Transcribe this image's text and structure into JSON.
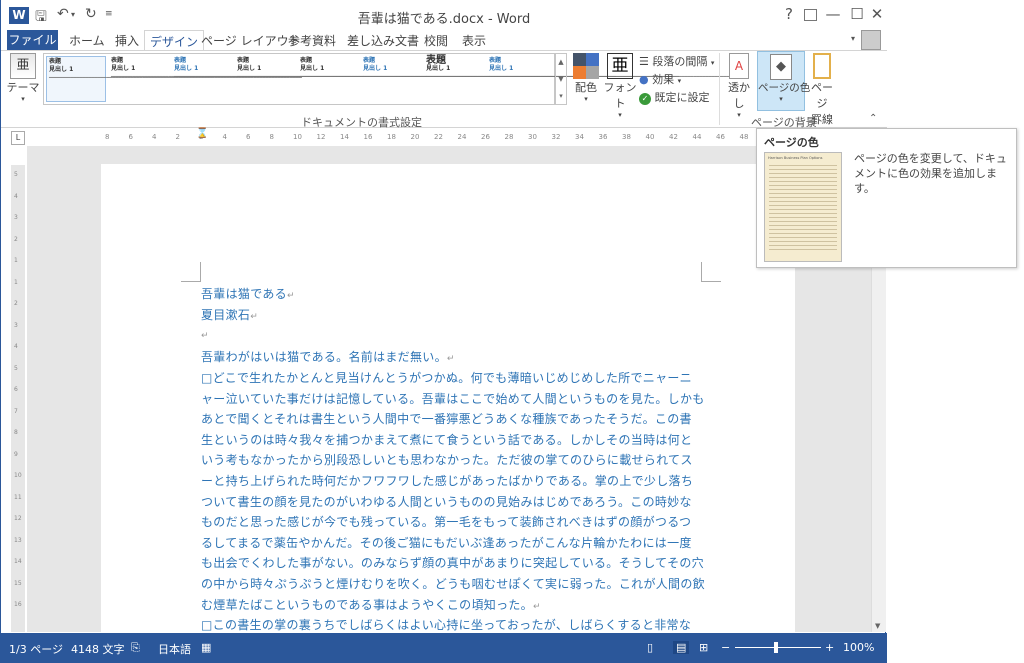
{
  "window": {
    "title": "吾輩は猫である.docx - Word",
    "controls": {
      "help": "?",
      "ribbon_opts": "⬆",
      "minimize": "—",
      "restore": "☐",
      "close": "✕"
    }
  },
  "tabs": {
    "file": "ファイル",
    "items": [
      "ホーム",
      "挿入",
      "デザイン",
      "ページ レイアウト",
      "参考資料",
      "差し込み文書",
      "校閲",
      "表示"
    ],
    "active": "デザイン"
  },
  "ribbon": {
    "theme": "テーマ",
    "styles": [
      {
        "name": "表題",
        "heading": "見出し 1"
      },
      {
        "name": "表題",
        "heading": "見出し 1"
      },
      {
        "name": "表題",
        "heading": "見出し 1"
      },
      {
        "name": "表題",
        "heading": "見出し 1"
      },
      {
        "name": "表題",
        "heading": "見出し 1"
      },
      {
        "name": "表題",
        "heading": "見出し 1"
      },
      {
        "name": "表題",
        "heading": "見出し 1"
      },
      {
        "name": "表題",
        "heading": "見出し 1"
      }
    ],
    "colors": "配色",
    "fonts": "フォント",
    "fonts_glyph": "亜",
    "paragraph_spacing": "段落の間隔",
    "effects": "効果",
    "set_default": "既定に設定",
    "group_format": "ドキュメントの書式設定",
    "watermark": "透かし",
    "page_color": "ページの色",
    "page_borders_1": "ページ",
    "page_borders_2": "罫線",
    "group_background": "ページの背景"
  },
  "ruler": {
    "h_ticks": [
      "8",
      "6",
      "4",
      "2",
      "2",
      "4",
      "6",
      "8",
      "10",
      "12",
      "14",
      "16",
      "18",
      "20",
      "22",
      "24",
      "26",
      "28",
      "30",
      "32",
      "34",
      "36",
      "38",
      "40",
      "42",
      "44",
      "46",
      "48"
    ],
    "v_ticks": [
      "5",
      "4",
      "3",
      "2",
      "1",
      "1",
      "2",
      "3",
      "4",
      "5",
      "6",
      "7",
      "8",
      "9",
      "10",
      "11",
      "12",
      "13",
      "14",
      "15",
      "16"
    ],
    "tab_marker": "L"
  },
  "document": {
    "title": "吾輩は猫である",
    "author": "夏目漱石",
    "para1": "吾輩わがはいは猫である。名前はまだ無い。",
    "para2_lines": [
      "□どこで生れたかとんと見当けんとうがつかぬ。何でも薄暗いじめじめした所でニャーニ",
      "ャー泣いていた事だけは記憶している。吾輩はここで始めて人間というものを見た。しかも",
      "あとで聞くとそれは書生という人間中で一番獰悪どうあくな種族であったそうだ。この書",
      "生というのは時々我々を捕つかまえて煮にて食うという話である。しかしその当時は何と",
      "いう考もなかったから別段恐しいとも思わなかった。ただ彼の掌てのひらに載せられてス",
      "ーと持ち上げられた時何だかフワフワした感じがあったばかりである。掌の上で少し落ち",
      "ついて書生の顔を見たのがいわゆる人間というものの見始みはじめであろう。この時妙な",
      "ものだと思った感じが今でも残っている。第一毛をもって装飾されべきはずの顔がつるつ",
      "るしてまるで薬缶やかんだ。その後ご猫にもだいぶ逢あったがこんな片輪かたわには一度",
      "も出会でくわした事がない。のみならず顔の真中があまりに突起している。そうしてその穴",
      "の中から時々ぷうぷうと煙けむりを吹く。どうも咽むせぽくて実に弱った。これが人間の飲",
      "む煙草たばこというものである事はようやくこの頃知った。"
    ],
    "para3": "□この書生の掌の裏うちでしばらくはよい心持に坐っておったが、しばらくすると非常な"
  },
  "tooltip": {
    "title": "ページの色",
    "description": "ページの色を変更して、ドキュメントに色の効果を追加します。",
    "thumb_title": "Harrison Business Plan Options"
  },
  "status": {
    "page": "1/3 ページ",
    "words": "4148 文字",
    "language": "日本語",
    "zoom": "100%",
    "zoom_minus": "−",
    "zoom_plus": "+"
  }
}
